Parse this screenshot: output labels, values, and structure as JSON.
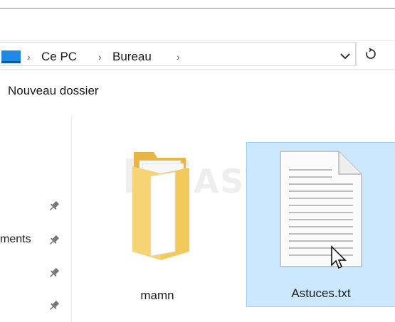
{
  "address": {
    "crumbs": [
      "Ce PC",
      "Bureau"
    ],
    "separator": "›"
  },
  "toolbar": {
    "new_folder_label": "Nouveau dossier"
  },
  "nav": {
    "partial_item": "ments"
  },
  "files": [
    {
      "name": "mamn",
      "type": "folder",
      "selected": false
    },
    {
      "name": "Astuces.txt",
      "type": "text-file",
      "selected": true
    }
  ],
  "watermark": {
    "text_main": "PC",
    "text_small": "ASTUCES"
  },
  "colors": {
    "selection_bg": "#cce8ff",
    "selection_border": "#99d1ff",
    "folder": "#f4c44e",
    "pc_icon": "#1e88e5"
  },
  "icons": [
    "pc-icon",
    "chevron-down-icon",
    "refresh-icon",
    "pin-icon",
    "folder-icon",
    "text-file-icon",
    "mouse-cursor-icon"
  ]
}
